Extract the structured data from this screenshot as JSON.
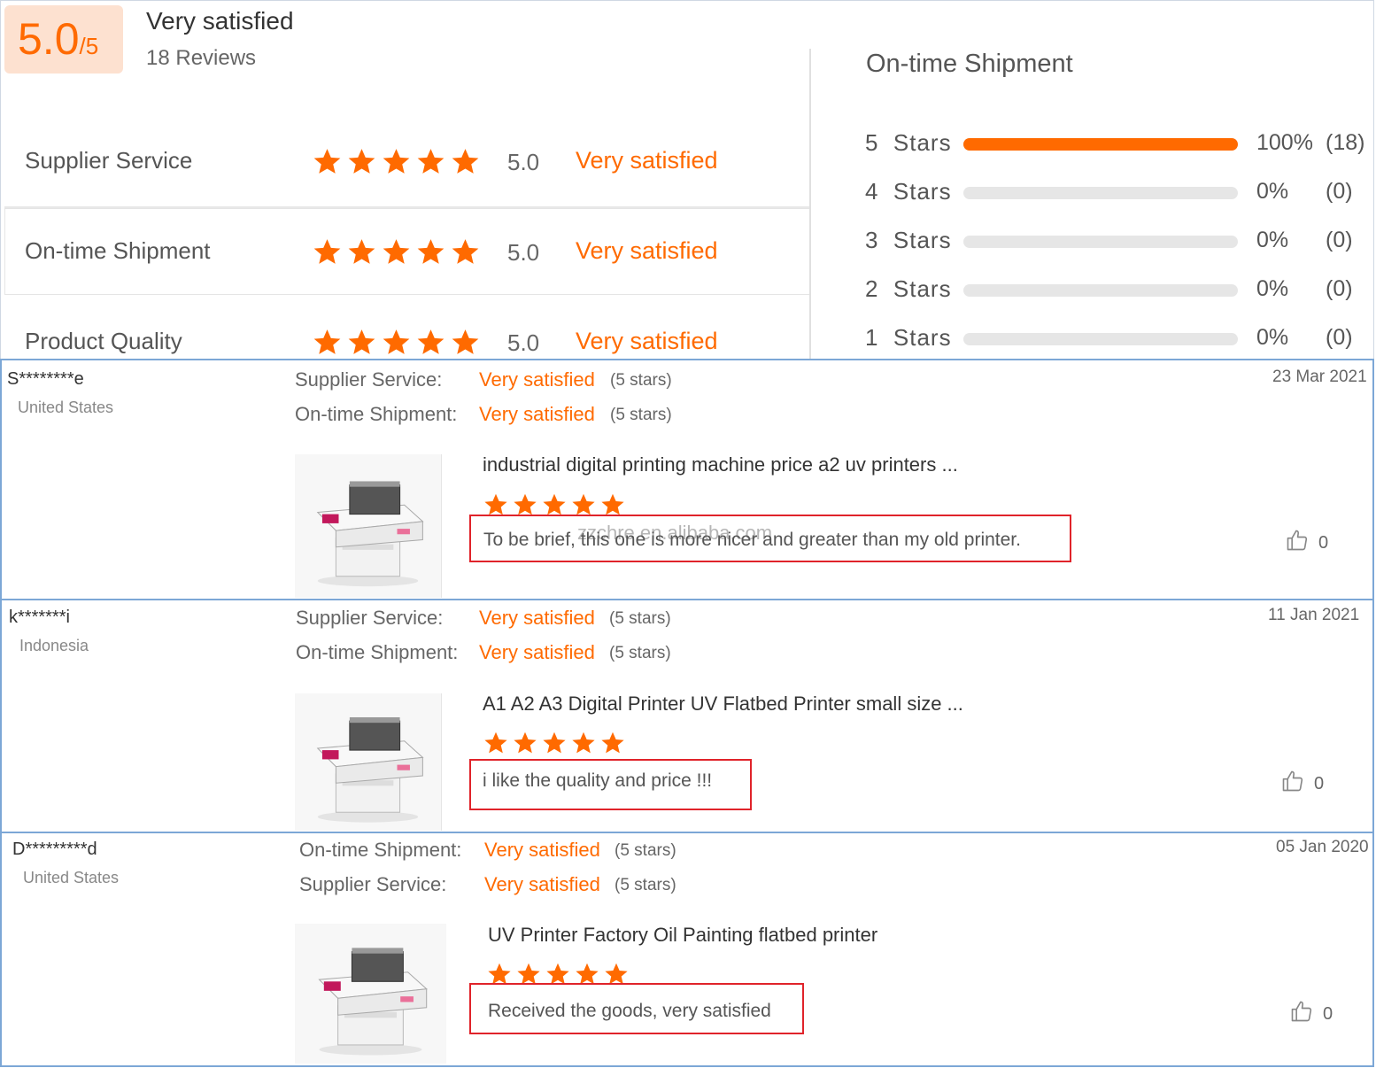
{
  "summary": {
    "score": "5.0",
    "score_out_of": "/5",
    "rating_text": "Very satisfied",
    "review_count": "18 Reviews",
    "categories": [
      {
        "label": "Supplier Service",
        "score": "5.0",
        "text": "Very satisfied",
        "stars": 5
      },
      {
        "label": "On-time Shipment",
        "score": "5.0",
        "text": "Very satisfied",
        "stars": 5
      },
      {
        "label": "Product Quality",
        "score": "5.0",
        "text": "Very satisfied",
        "stars": 5
      }
    ],
    "distribution_title": "On-time Shipment",
    "distribution": [
      {
        "label": "5  Stars",
        "percent": "100%",
        "count": "(18)",
        "fraction": 1.0
      },
      {
        "label": "4  Stars",
        "percent": "0%",
        "count": "(0)",
        "fraction": 0
      },
      {
        "label": "3  Stars",
        "percent": "0%",
        "count": "(0)",
        "fraction": 0
      },
      {
        "label": "2  Stars",
        "percent": "0%",
        "count": "(0)",
        "fraction": 0
      },
      {
        "label": "1  Stars",
        "percent": "0%",
        "count": "(0)",
        "fraction": 0
      }
    ]
  },
  "reviews": [
    {
      "name": "S********e",
      "country": "United States",
      "date": "23 Mar 2021",
      "lines": [
        {
          "label": "Supplier Service:",
          "value": "Very satisfied",
          "stars": "(5 stars)"
        },
        {
          "label": "On-time Shipment:",
          "value": "Very satisfied",
          "stars": "(5 stars)"
        }
      ],
      "product_title": "industrial digital printing machine price a2 uv printers ...",
      "product_stars": 5,
      "comment": "To be brief, this one is more nicer and greater than my old printer.",
      "likes": "0",
      "watermark": "zzchre.en.alibaba.com"
    },
    {
      "name": "k*******i",
      "country": "Indonesia",
      "date": "11 Jan 2021",
      "lines": [
        {
          "label": "Supplier Service:",
          "value": "Very satisfied",
          "stars": "(5 stars)"
        },
        {
          "label": "On-time Shipment:",
          "value": "Very satisfied",
          "stars": "(5 stars)"
        }
      ],
      "product_title": "A1 A2 A3 Digital Printer UV Flatbed Printer small size ...",
      "product_stars": 5,
      "comment": "i like the quality and price !!!",
      "likes": "0"
    },
    {
      "name": "D*********d",
      "country": "United States",
      "date": "05 Jan 2020",
      "lines": [
        {
          "label": "On-time Shipment:",
          "value": "Very satisfied",
          "stars": "(5 stars)"
        },
        {
          "label": "Supplier Service:",
          "value": "Very satisfied",
          "stars": "(5 stars)"
        }
      ],
      "product_title": "UV Printer Factory Oil Painting flatbed printer",
      "product_stars": 5,
      "comment": "Received the goods, very satisfied",
      "likes": "0"
    }
  ],
  "colors": {
    "accent": "#ff6a00",
    "comment_border": "#e0232a",
    "review_border": "#7ca7d6"
  },
  "icons": {
    "star": "star-icon",
    "like": "thumbs-up-icon",
    "product": "uv-printer-image"
  }
}
